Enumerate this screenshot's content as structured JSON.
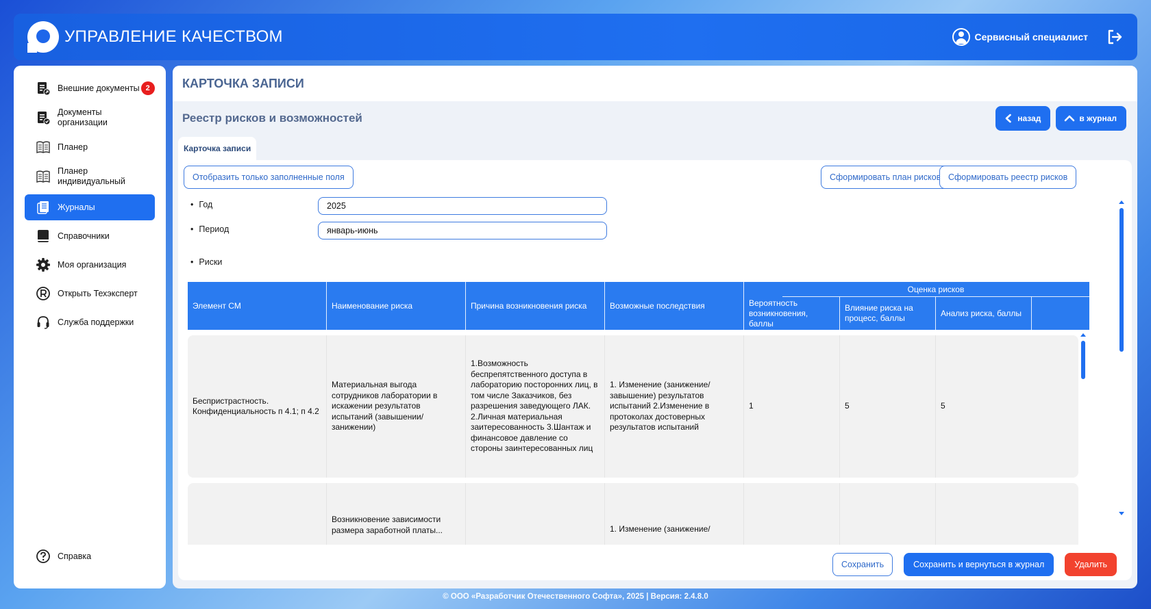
{
  "header": {
    "app_title": "УПРАВЛЕНИЕ КАЧЕСТВОМ",
    "user_name": "Сервисный специалист"
  },
  "sidebar": {
    "items": [
      {
        "label": "Внешние документы",
        "badge": "2",
        "icon": "external-docs-icon"
      },
      {
        "label": "Документы организации",
        "icon": "org-docs-icon"
      },
      {
        "label": "Планер",
        "icon": "planner-icon"
      },
      {
        "label": "Планер индивидуальный",
        "icon": "planner-individual-icon"
      },
      {
        "label": "Журналы",
        "icon": "journals-icon",
        "active": true
      },
      {
        "label": "Справочники",
        "icon": "book-icon"
      },
      {
        "label": "Моя организация",
        "icon": "gear-icon"
      },
      {
        "label": "Открыть Техэксперт",
        "icon": "registered-icon"
      },
      {
        "label": "Служба поддержки",
        "icon": "headset-icon"
      }
    ],
    "help_label": "Справка"
  },
  "main": {
    "card_title": "КАРТОЧКА ЗАПИСИ",
    "registry_title": "Реестр рисков и возможностей",
    "back_label": "назад",
    "to_journal_label": "в журнал",
    "tab_label": "Карточка записи",
    "show_filled_label": "Отобразить только заполненные поля",
    "form_plan_label": "Сформировать план рисков",
    "form_registry_label": "Сформировать реестр рисков"
  },
  "form": {
    "year_label": "Год",
    "year_value": "2025",
    "period_label": "Период",
    "period_value": "январь-июнь",
    "risks_label": "Риски"
  },
  "table": {
    "headers": [
      "Элемент СМ",
      "Наименование риска",
      "Причина возникновения риска",
      "Возможные последствия"
    ],
    "group_header": "Оценка рисков",
    "sub_headers": [
      "Вероятность возникновения, баллы",
      "Влияние риска на процесс, баллы",
      "Анализ риска, баллы"
    ],
    "rows": [
      {
        "element": "Беспристрастность. Конфиденциальность п 4.1; п 4.2",
        "name": "Материальная выгода сотрудников лаборатории в искажении результатов испытаний (завышении/занижении)",
        "cause": "1.Возможность беспрепятственного доступа в лабораторию посторонних лиц, в том числе Заказчиков, без разрешения заведующего ЛАК. 2.Личная материальная заитересованность 3.Шантаж и финансовое давление со стороны заинтересованных лиц",
        "consequences": "1. Изменение (занижение/завышение) результатов испытаний 2.Изменение в протоколах достоверных результатов испытаний",
        "probability": "1",
        "impact": "5",
        "analysis": "5"
      },
      {
        "element": "",
        "name": "Возникновение зависимости размера заработной платы...",
        "cause": "",
        "consequences": "1. Изменение (занижение/",
        "probability": "",
        "impact": "",
        "analysis": ""
      }
    ]
  },
  "footer": {
    "save_label": "Сохранить",
    "save_return_label": "Сохранить и вернуться в журнал",
    "delete_label": "Удалить",
    "copyright": "© ООО «Разработчик Отечественного Софта», 2025 | Версия: 2.4.8.0"
  }
}
